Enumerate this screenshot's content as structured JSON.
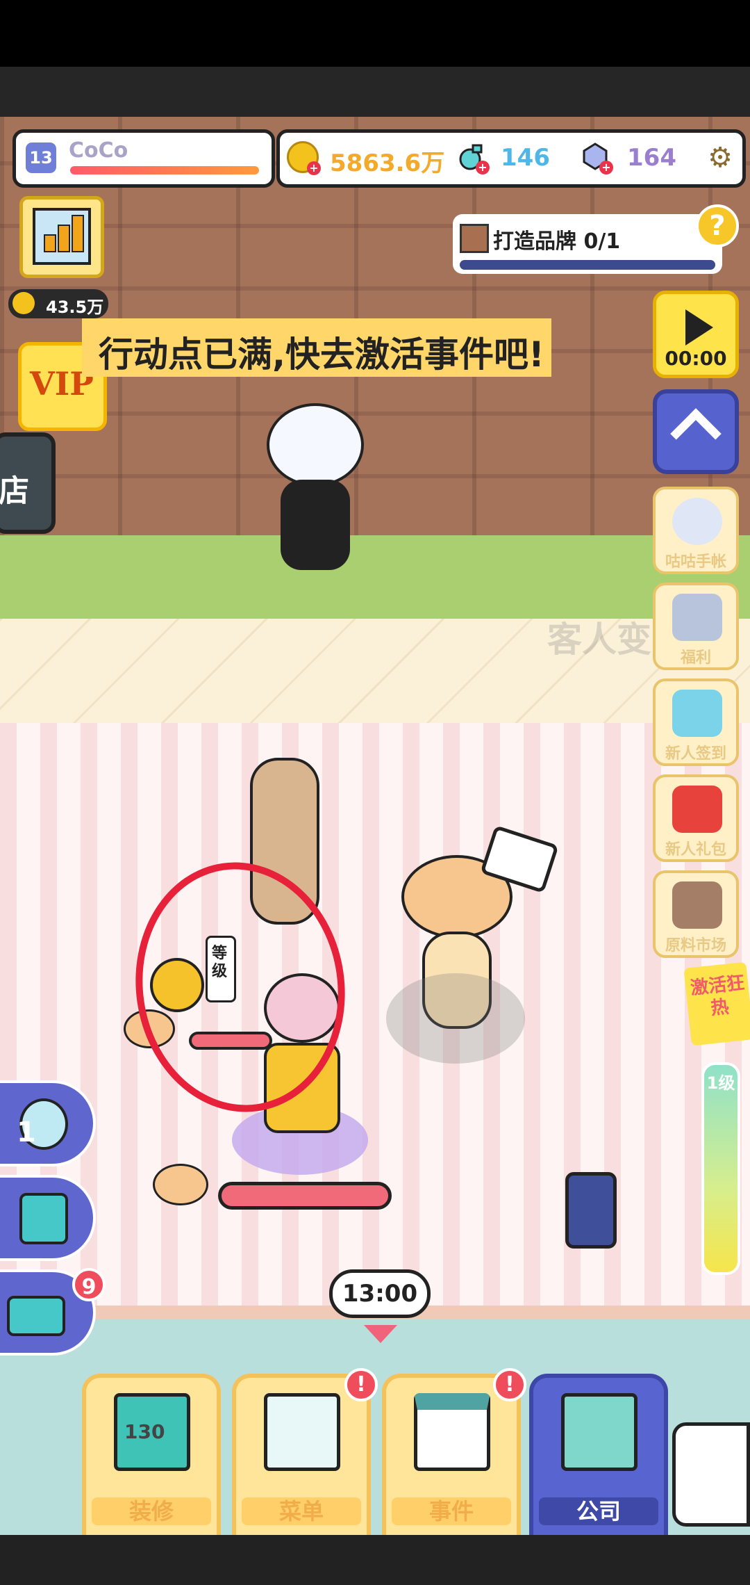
{
  "player": {
    "level": "13",
    "name": "CoCo"
  },
  "resources": {
    "coins": "5863.6万",
    "potions": "146",
    "gems": "164"
  },
  "income": "43.5万",
  "vip_label": "VIP",
  "shop_label": "店",
  "banner_text": "行动点已满,快去激活事件吧!",
  "quest": {
    "label": "打造品牌 0/1",
    "help": "?"
  },
  "timer": "00:00",
  "side_menu": [
    "咕咕手帐",
    "福利",
    "新人签到",
    "新人礼包",
    "原料市场"
  ],
  "hype_label": "激活狂热",
  "meter_label": "1级",
  "ghost_text": "客人变",
  "level_bubble": "等级",
  "left_tools": {
    "magnifier_count": "1",
    "inbox_badge": "9"
  },
  "clock": "13:00",
  "tabs": [
    {
      "label": "装修",
      "count": "130",
      "alert": false
    },
    {
      "label": "菜单",
      "alert": true
    },
    {
      "label": "事件",
      "alert": true
    },
    {
      "label": "公司",
      "alert": false
    }
  ],
  "alert_mark": "!",
  "colors": {
    "accent_blue": "#5865d1",
    "yellow": "#ffe34a",
    "red": "#ef4d5c"
  }
}
